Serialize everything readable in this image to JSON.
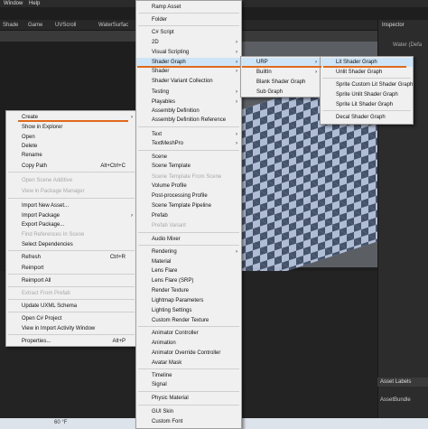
{
  "editor": {
    "menubar": [
      "Window",
      "Help"
    ],
    "tabs": [
      "Shade",
      "Game",
      "UVScroll",
      "WaterSurfac",
      "Inspector"
    ],
    "inspector_title": "Inspector",
    "inspector_sub": "Water (Defa",
    "asset_labels": "Asset Labels",
    "asset_bundle": "AssetBundle",
    "weather": "60 °F"
  },
  "project_menu": {
    "items": [
      {
        "label": "Create",
        "arrow": true
      },
      {
        "label": "Show in Explorer"
      },
      {
        "label": "Open"
      },
      {
        "label": "Delete"
      },
      {
        "label": "Rename"
      },
      {
        "label": "Copy Path",
        "shortcut": "Alt+Ctrl+C"
      },
      {
        "label": "Open Scene Additive",
        "disabled": true
      },
      {
        "label": "View in Package Manager",
        "disabled": true
      },
      {
        "label": "Import New Asset..."
      },
      {
        "label": "Import Package",
        "arrow": true
      },
      {
        "label": "Export Package..."
      },
      {
        "label": "Find References In Scene",
        "disabled": true
      },
      {
        "label": "Select Dependencies"
      },
      {
        "label": "Refresh",
        "shortcut": "Ctrl+R"
      },
      {
        "label": "Reimport"
      },
      {
        "label": "Reimport All"
      },
      {
        "label": "Extract From Prefab",
        "disabled": true
      },
      {
        "label": "Update UXML Schema"
      },
      {
        "label": "Open C# Project"
      },
      {
        "label": "View in Import Activity Window"
      },
      {
        "label": "Properties...",
        "shortcut": "Alt+P"
      }
    ]
  },
  "create_menu": {
    "items": [
      {
        "label": "Ramp Asset"
      },
      {
        "label": "Folder"
      },
      {
        "label": "C# Script"
      },
      {
        "label": "2D",
        "arrow": true
      },
      {
        "label": "Visual Scripting",
        "arrow": true
      },
      {
        "label": "Shader Graph",
        "arrow": true
      },
      {
        "label": "Shader",
        "arrow": true
      },
      {
        "label": "Shader Variant Collection"
      },
      {
        "label": "Testing",
        "arrow": true
      },
      {
        "label": "Playables",
        "arrow": true
      },
      {
        "label": "Assembly Definition"
      },
      {
        "label": "Assembly Definition Reference"
      },
      {
        "label": "Text",
        "arrow": true
      },
      {
        "label": "TextMeshPro",
        "arrow": true
      },
      {
        "label": "Scene"
      },
      {
        "label": "Scene Template"
      },
      {
        "label": "Scene Template From Scene",
        "disabled": true
      },
      {
        "label": "Volume Profile"
      },
      {
        "label": "Post-processing Profile"
      },
      {
        "label": "Scene Template Pipeline"
      },
      {
        "label": "Prefab"
      },
      {
        "label": "Prefab Variant",
        "disabled": true
      },
      {
        "label": "Audio Mixer"
      },
      {
        "label": "Rendering",
        "arrow": true
      },
      {
        "label": "Material"
      },
      {
        "label": "Lens Flare"
      },
      {
        "label": "Lens Flare (SRP)"
      },
      {
        "label": "Render Texture"
      },
      {
        "label": "Lightmap Parameters"
      },
      {
        "label": "Lighting Settings"
      },
      {
        "label": "Custom Render Texture"
      },
      {
        "label": "Animator Controller"
      },
      {
        "label": "Animation"
      },
      {
        "label": "Animator Override Controller"
      },
      {
        "label": "Avatar Mask"
      },
      {
        "label": "Timeline"
      },
      {
        "label": "Signal"
      },
      {
        "label": "Physic Material"
      },
      {
        "label": "GUI Skin"
      },
      {
        "label": "Custom Font"
      }
    ]
  },
  "shadergraph_menu": {
    "items": [
      {
        "label": "URP",
        "arrow": true
      },
      {
        "label": "BuiltIn",
        "arrow": true
      },
      {
        "label": "Blank Shader Graph"
      },
      {
        "label": "Sub Graph"
      }
    ]
  },
  "urp_menu": {
    "items": [
      {
        "label": "Lit Shader Graph"
      },
      {
        "label": "Unlit Shader Graph"
      },
      {
        "label": "Sprite Custom Lit Shader Graph"
      },
      {
        "label": "Sprite Unlit Shader Graph"
      },
      {
        "label": "Sprite Lit Shader Graph"
      },
      {
        "label": "Decal Shader Graph"
      }
    ]
  },
  "colors": {
    "highlight": "#e06a1c",
    "menu_bg": "#f0f0f0"
  }
}
